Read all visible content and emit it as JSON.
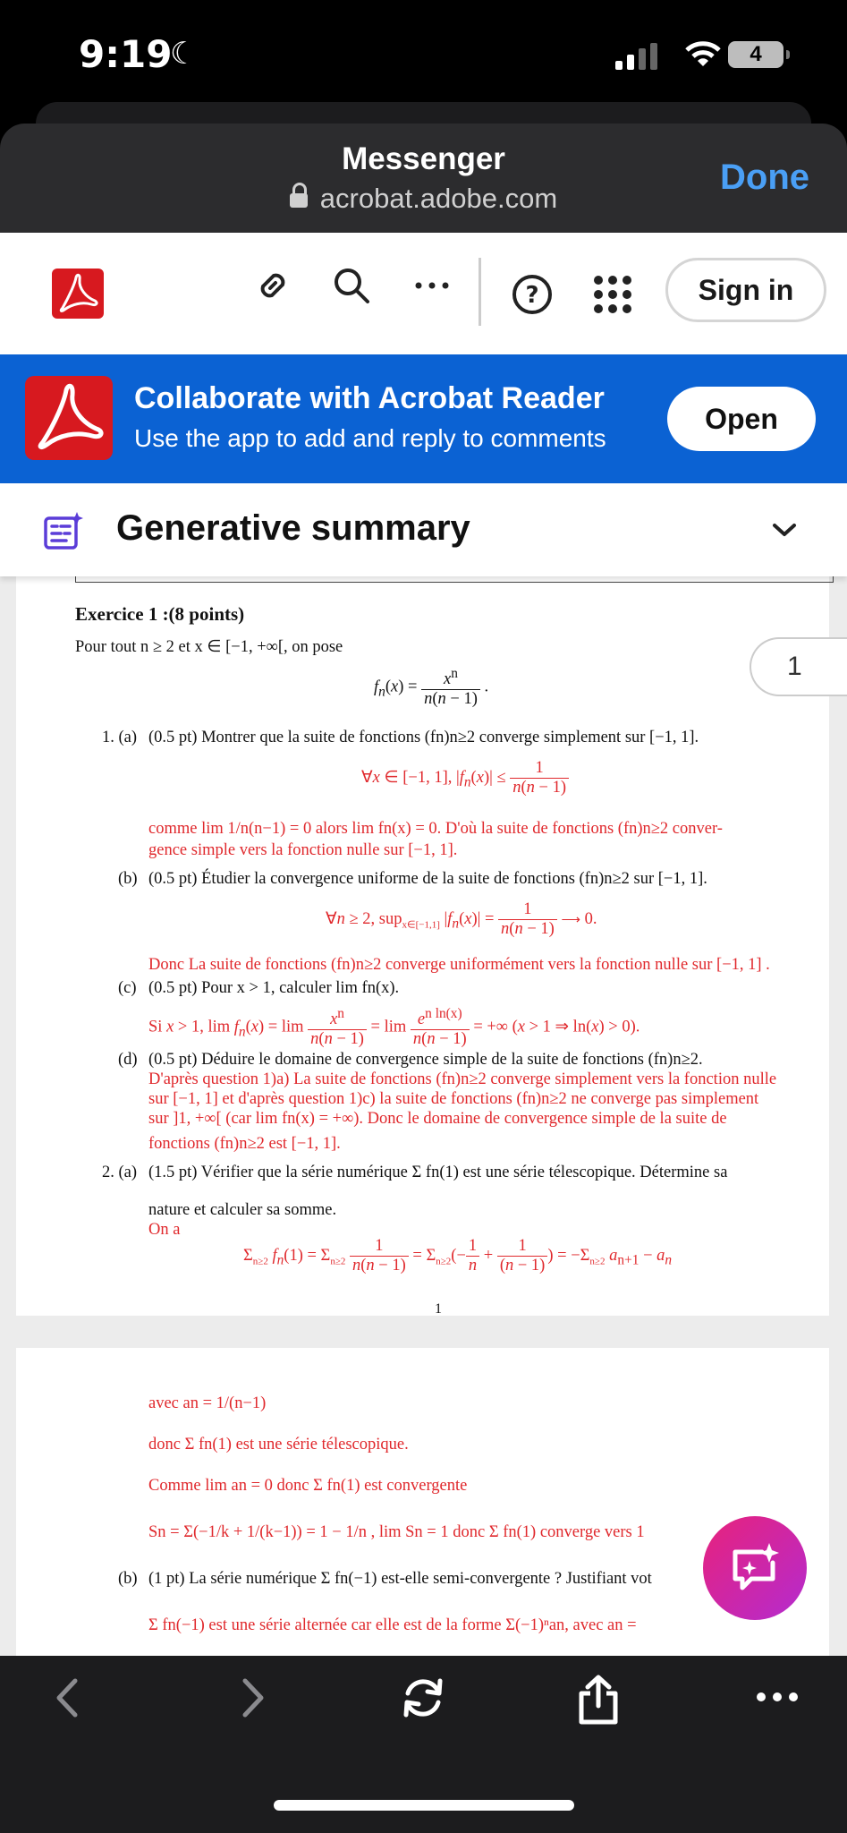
{
  "status_bar": {
    "time": "9:19",
    "battery": "4"
  },
  "header": {
    "title": "Messenger",
    "url": "acrobat.adobe.com",
    "done": "Done"
  },
  "toolbar": {
    "sign_in": "Sign in"
  },
  "banner": {
    "title": "Collaborate with Acrobat Reader",
    "subtitle": "Use the app to add and reply to comments",
    "open": "Open"
  },
  "summary": {
    "title": "Generative summary"
  },
  "page_badge": "1",
  "document": {
    "exercise_title": "Exercice 1 :(8 points)",
    "intro": "Pour tout n ≥ 2 et x ∈ [−1, +∞[, on pose",
    "q1a": "(0.5 pt) Montrer que la suite de fonctions (fn)n≥2 converge simplement sur [−1, 1].",
    "q1a_label": "1. (a)",
    "a1a_line1": "comme lim 1/n(n−1) = 0 alors lim fn(x) = 0. D'où la suite de fonctions (fn)n≥2 conver-",
    "a1a_line2": "gence simple vers la fonction nulle sur [−1, 1].",
    "q1b_label": "(b)",
    "q1b": "(0.5 pt) Étudier la convergence uniforme de la suite de fonctions (fn)n≥2 sur [−1, 1].",
    "a1b": "Donc La suite de fonctions (fn)n≥2 converge uniformément vers la fonction nulle sur [−1, 1] .",
    "q1c_label": "(c)",
    "q1c": "(0.5 pt) Pour x > 1, calculer lim fn(x).",
    "q1d_label": "(d)",
    "q1d": "(0.5 pt) Déduire le domaine de convergence simple de la suite de fonctions (fn)n≥2.",
    "a1d_l1": "D'après question 1)a) La suite de fonctions (fn)n≥2 converge simplement vers la fonction nulle",
    "a1d_l2": "sur [−1, 1] et d'après question 1)c) la suite de fonctions (fn)n≥2 ne converge pas simplement",
    "a1d_l3": "sur ]1, +∞[ (car lim fn(x) = +∞). Donc le domaine de convergence simple de la suite de",
    "a1d_l4": "fonctions (fn)n≥2 est [−1, 1].",
    "q2a_label": "2. (a)",
    "q2a_l1": "(1.5 pt) Vérifier que la série numérique Σ fn(1) est une série télescopique. Détermine sa",
    "q2a_l2": "nature et calculer sa somme.",
    "a2a_on": "On a",
    "page1_number": "1",
    "p2_avec": "avec an = 1/(n−1)",
    "p2_donc": "donc Σ fn(1) est une série télescopique.",
    "p2_comme": "Comme lim an = 0 donc Σ fn(1) est convergente",
    "p2_sn": "Sn = Σ(−1/k + 1/(k−1)) = 1 − 1/n , lim Sn = 1 donc Σ fn(1) converge vers 1",
    "q2b_label": "(b)",
    "q2b": "(1 pt) La série numérique Σ fn(−1) est-elle semi-convergente ? Justifiant vot",
    "a2b": "Σ fn(−1) est une série alternée car elle est de la forme Σ(−1)ⁿan, avec an ="
  }
}
